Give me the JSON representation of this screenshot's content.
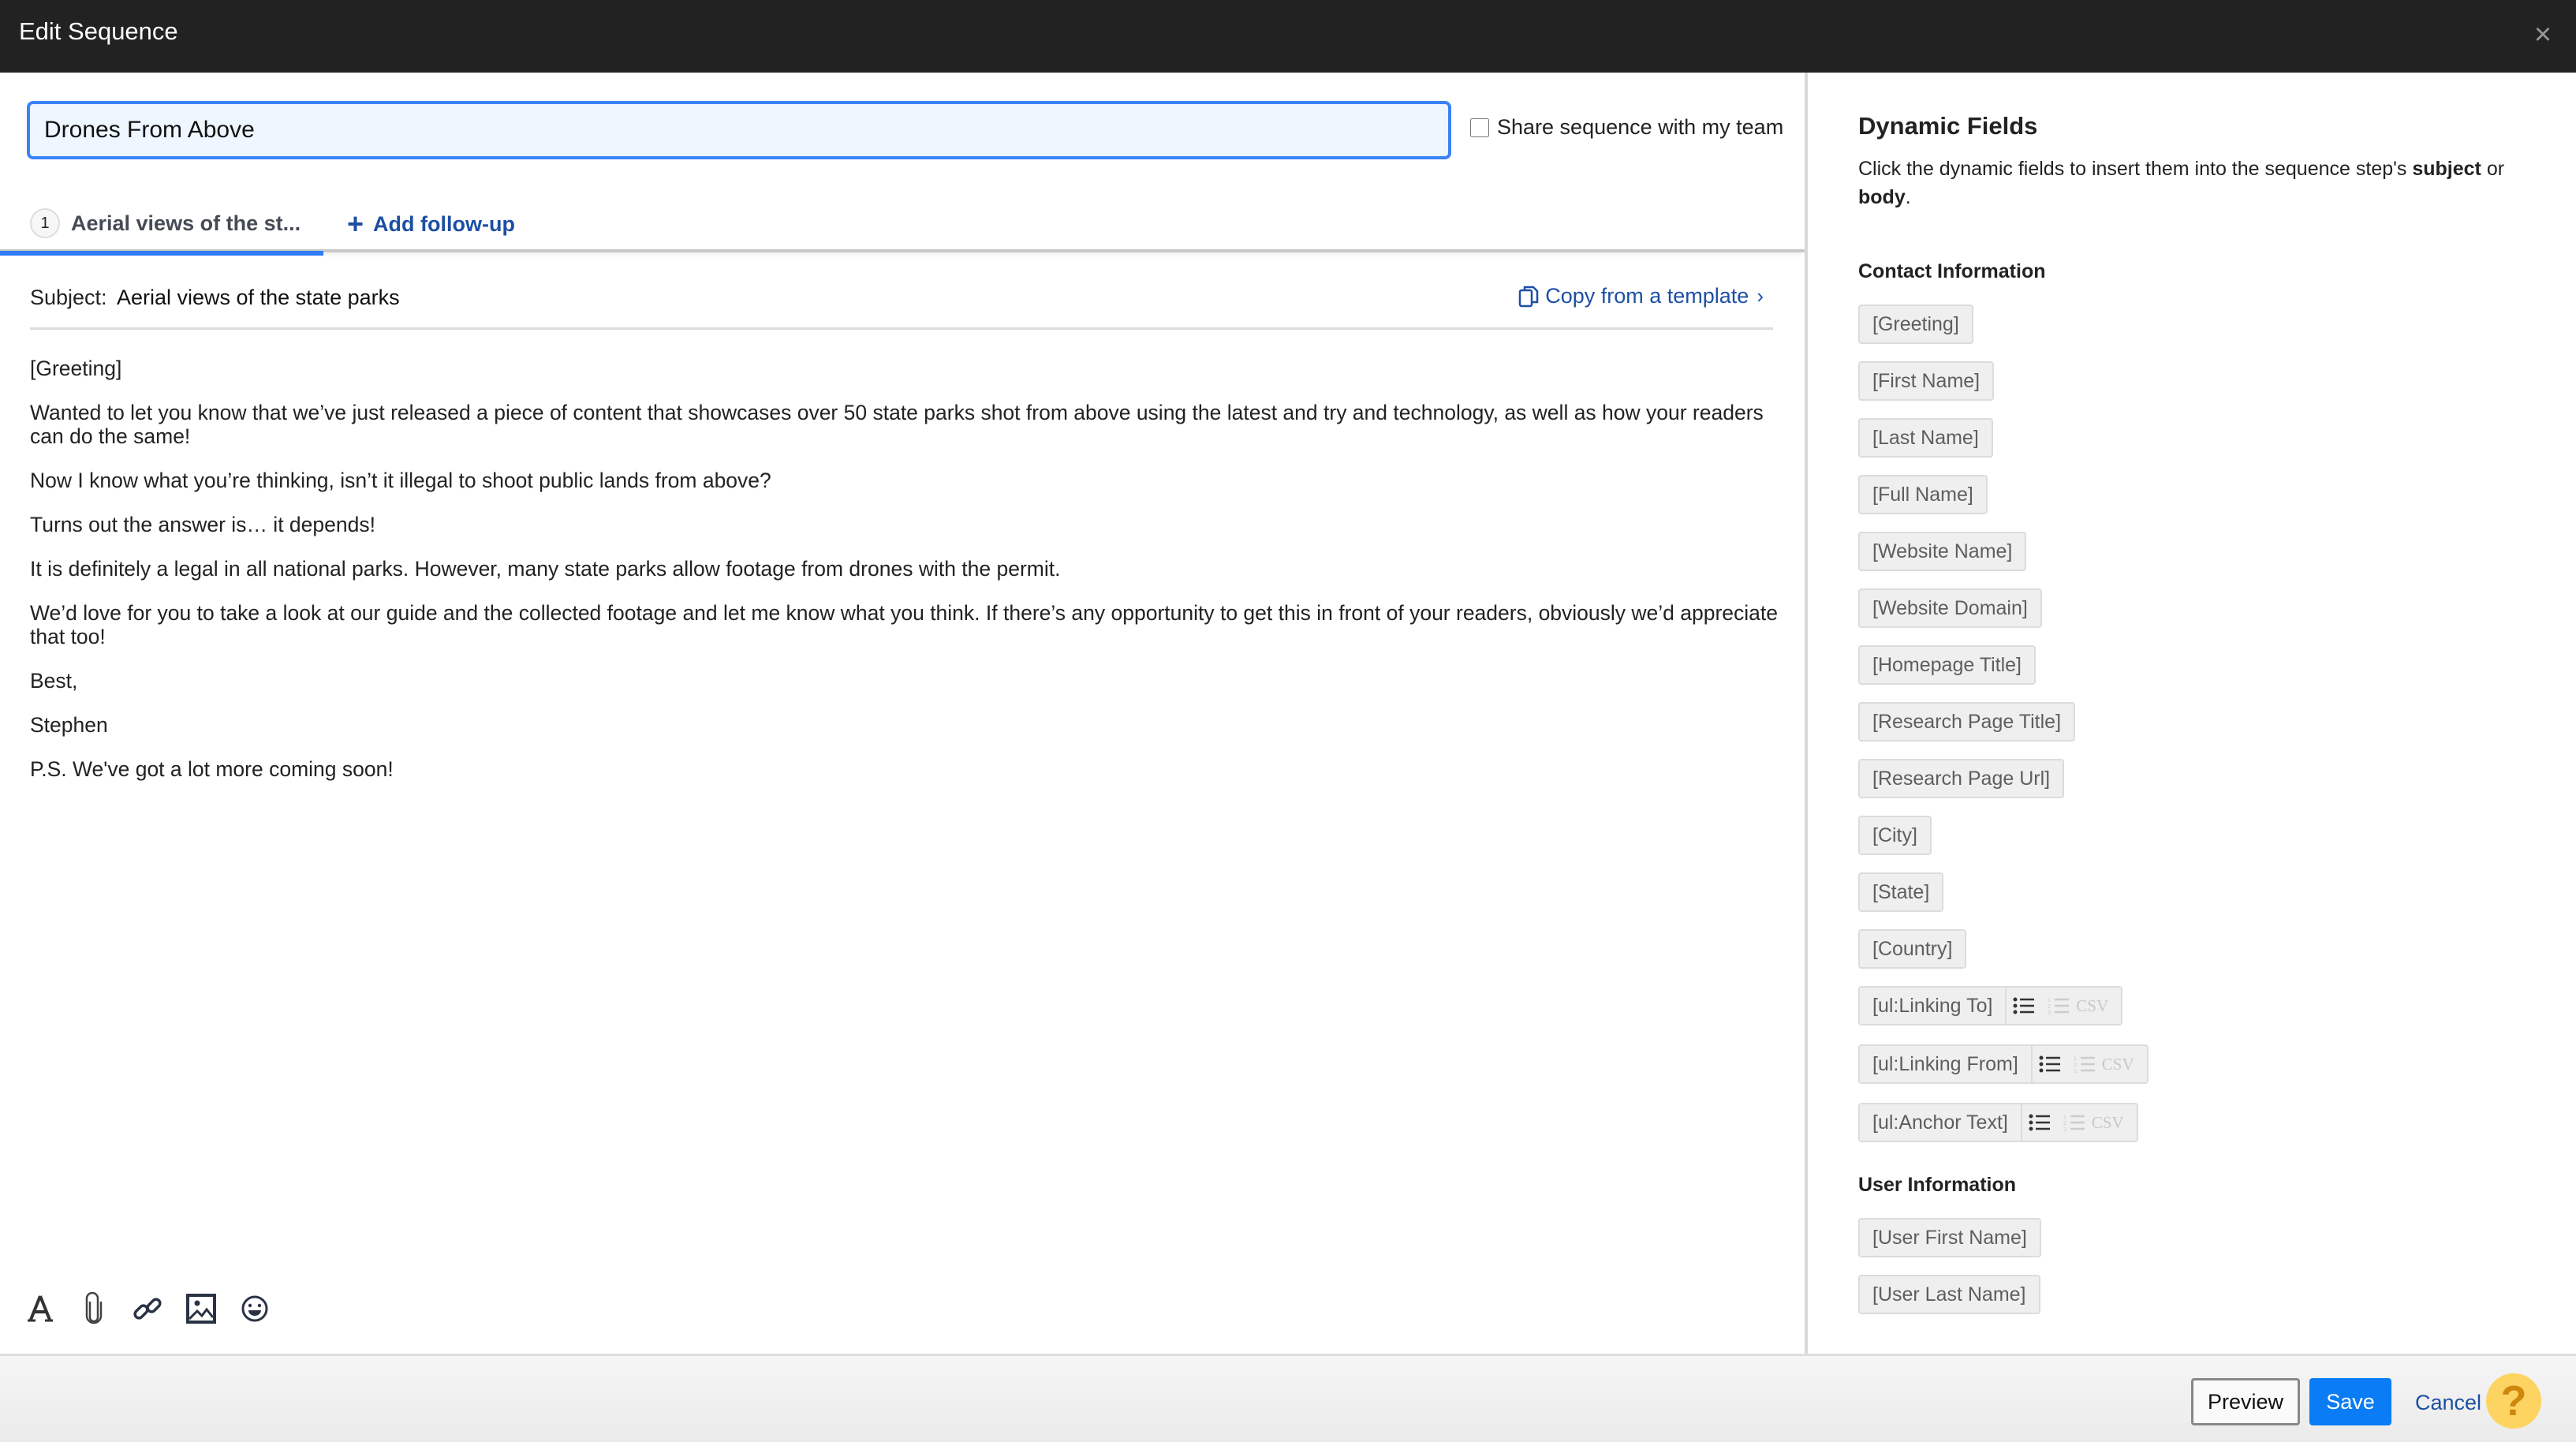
{
  "header": {
    "title": "Edit Sequence",
    "close_icon": "close-icon"
  },
  "editor": {
    "sequence_name": "Drones From Above",
    "share_label": "Share sequence with my team",
    "share_checked": false,
    "tabs": [
      {
        "step": "1",
        "label": "Aerial views of the st...",
        "active": true
      }
    ],
    "add_followup_label": "Add follow-up",
    "subject_label": "Subject:",
    "subject_value": "Aerial views of the state parks",
    "copy_template_label": "Copy from a template",
    "body_paragraphs": [
      "[Greeting]",
      "Wanted to let you know that we’ve just released a piece of content that showcases over 50 state parks shot from above using the latest and try and technology, as well as how your readers can do the same!",
      "Now I know what you’re thinking, isn’t it illegal to shoot public lands from above?",
      "Turns out the answer is… it depends!",
      "It is definitely a legal in all national parks. However, many state parks allow footage from drones with the permit.",
      "We’d love for you to take a look at our guide and the collected footage and let me know what you think. If there’s any opportunity to get this in front of your readers, obviously we’d appreciate that too!",
      "Best,",
      "Stephen",
      "P.S. We've got a lot more coming soon!"
    ],
    "toolbar": [
      "font-icon",
      "paperclip-icon",
      "link-icon",
      "image-icon",
      "emoji-icon"
    ]
  },
  "dynamic_fields": {
    "title": "Dynamic Fields",
    "description_prefix": "Click the dynamic fields to insert them into the sequence step's ",
    "description_bold1": "subject",
    "description_mid": " or ",
    "description_bold2": "body",
    "description_suffix": ".",
    "contact_heading": "Contact Information",
    "contact_fields": [
      "[Greeting]",
      "[First Name]",
      "[Last Name]",
      "[Full Name]",
      "[Website Name]",
      "[Website Domain]",
      "[Homepage Title]",
      "[Research Page Title]",
      "[Research Page Url]",
      "[City]",
      "[State]",
      "[Country]"
    ],
    "list_fields": [
      "[ul:Linking To]",
      "[ul:Linking From]",
      "[ul:Anchor Text]"
    ],
    "csv_label": "CSV",
    "user_heading": "User Information",
    "user_fields": [
      "[User First Name]",
      "[User Last Name]"
    ]
  },
  "footer": {
    "preview_label": "Preview",
    "save_label": "Save",
    "cancel_label": "Cancel",
    "help_label": "?"
  },
  "colors": {
    "header_bg": "#222222",
    "accent_blue": "#2f7cf6",
    "save_blue": "#0a7cf5",
    "link_blue": "#1d4fa3",
    "help_yellow": "#fdd462"
  }
}
